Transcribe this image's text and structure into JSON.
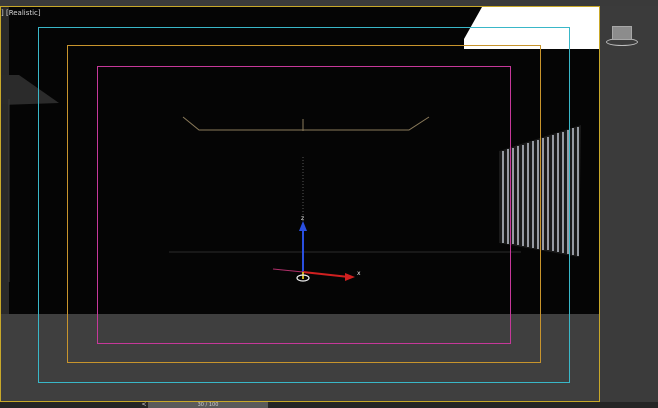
{
  "viewport": {
    "label_open": "] [",
    "shading_mode": "Realistic",
    "label_close": "]"
  },
  "gizmo": {
    "z_label": "z",
    "x_label": "x"
  },
  "timeslider": {
    "prev_label": "<",
    "frame_text": "30 / 100"
  },
  "colors": {
    "viewport_border": "#c8a829",
    "safe_frame_outer": "#39b7c8",
    "safe_frame_mid": "#c8942c",
    "safe_frame_inner": "#c6389a"
  },
  "icons": {
    "viewcube": "viewcube-icon",
    "move_gizmo": "move-gizmo-icon",
    "light_panel": "light-panel-icon"
  }
}
